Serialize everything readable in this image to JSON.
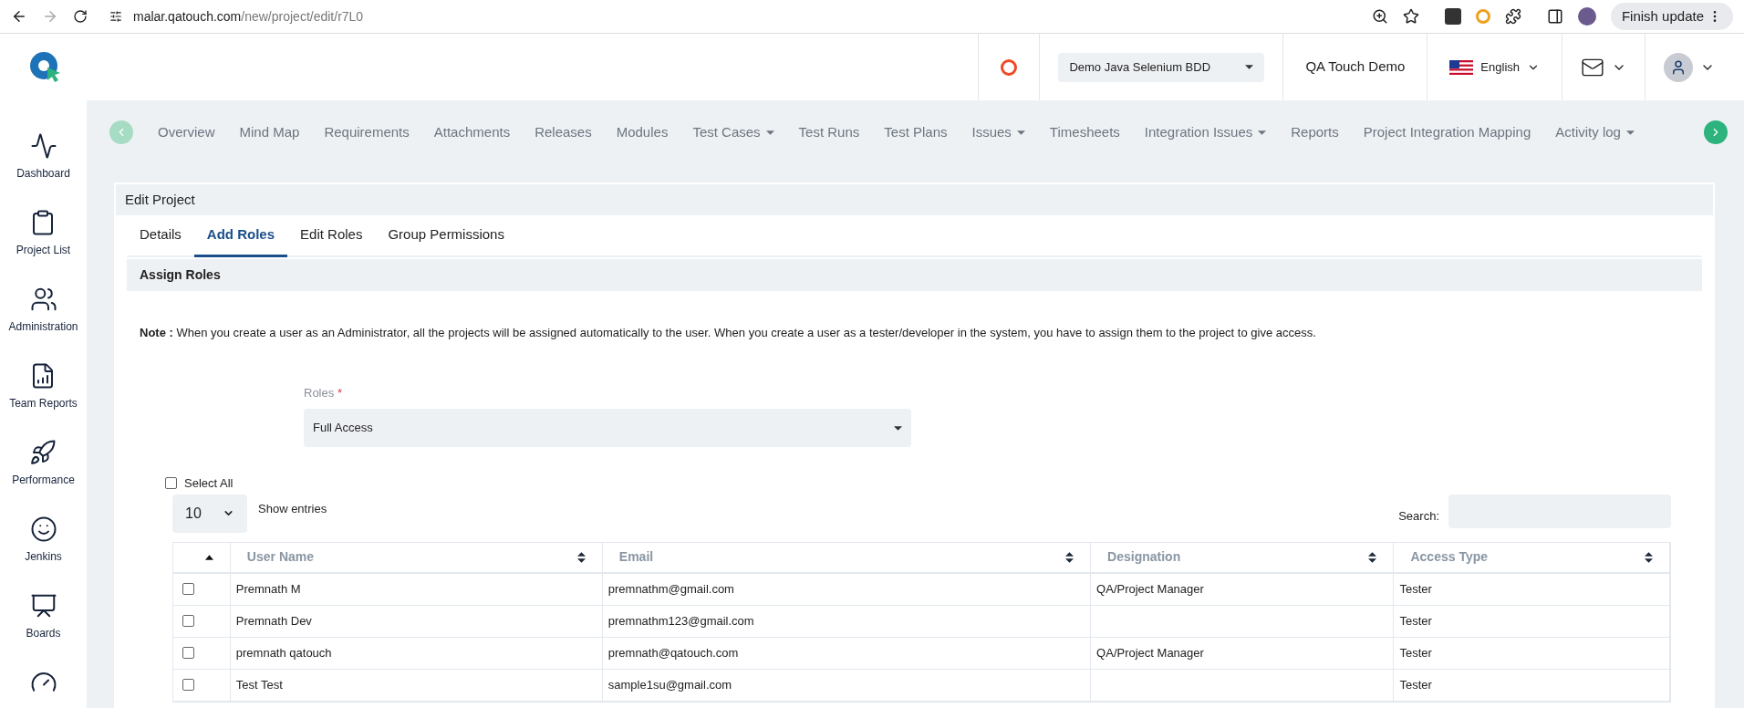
{
  "browser": {
    "url_host": "malar.qatouch.com",
    "url_path": "/new/project/edit/r7L0",
    "update_button": "Finish update"
  },
  "header": {
    "project_select": "Demo Java Selenium BDD",
    "workspace": "QA Touch Demo",
    "language": "English"
  },
  "sidebar": {
    "items": [
      {
        "label": "Dashboard"
      },
      {
        "label": "Project List"
      },
      {
        "label": "Administration"
      },
      {
        "label": "Team Reports"
      },
      {
        "label": "Performance"
      },
      {
        "label": "Jenkins"
      },
      {
        "label": "Boards"
      }
    ]
  },
  "nav": {
    "items": [
      {
        "label": "Overview",
        "dropdown": false
      },
      {
        "label": "Mind Map",
        "dropdown": false
      },
      {
        "label": "Requirements",
        "dropdown": false
      },
      {
        "label": "Attachments",
        "dropdown": false
      },
      {
        "label": "Releases",
        "dropdown": false
      },
      {
        "label": "Modules",
        "dropdown": false
      },
      {
        "label": "Test Cases",
        "dropdown": true
      },
      {
        "label": "Test Runs",
        "dropdown": false
      },
      {
        "label": "Test Plans",
        "dropdown": false
      },
      {
        "label": "Issues",
        "dropdown": true
      },
      {
        "label": "Timesheets",
        "dropdown": false
      },
      {
        "label": "Integration Issues",
        "dropdown": true
      },
      {
        "label": "Reports",
        "dropdown": false
      },
      {
        "label": "Project Integration Mapping",
        "dropdown": false
      },
      {
        "label": "Activity log",
        "dropdown": true
      }
    ]
  },
  "panel": {
    "title": "Edit Project",
    "section": "Assign Roles"
  },
  "tabs": [
    {
      "label": "Details",
      "selected": false
    },
    {
      "label": "Add Roles",
      "selected": true
    },
    {
      "label": "Edit Roles",
      "selected": false
    },
    {
      "label": "Group Permissions",
      "selected": false
    }
  ],
  "note": "**Note :** When you create a user as an Administrator, all the projects will be assigned automatically to the user. When you create a user as a tester/developer in the system, you have to assign them to the project to give access.",
  "roles": {
    "label": "Roles",
    "required_mark": "*",
    "value": "Full Access"
  },
  "select_all": {
    "label": "Select All",
    "checked": false
  },
  "page_length": {
    "value": "10",
    "label": "Show entries"
  },
  "search": {
    "label": "Search:"
  },
  "table": {
    "columns": [
      {
        "sorted_ascending": true
      },
      {
        "label": "User Name",
        "sorted_ascending": false
      },
      {
        "label": "Email",
        "sorted_ascending": false
      },
      {
        "label": "Designation",
        "sorted_ascending": false
      },
      {
        "label": "Access Type",
        "sorted_ascending": false
      }
    ],
    "rows": [
      {
        "checked": false,
        "user_name": "Premnath M",
        "email": "premnathm@gmail.com",
        "designation": "QA/Project Manager",
        "access_type": "Tester"
      },
      {
        "checked": false,
        "user_name": "Premnath Dev",
        "email": "premnathm123@gmail.com",
        "access_type": "Tester"
      },
      {
        "checked": false,
        "user_name": "premnath qatouch",
        "email": "premnath@qatouch.com",
        "designation": "QA/Project Manager",
        "access_type": "Tester"
      },
      {
        "checked": false,
        "user_name": "Test Test",
        "email": "sample1su@gmail.com",
        "access_type": "Tester"
      }
    ]
  }
}
